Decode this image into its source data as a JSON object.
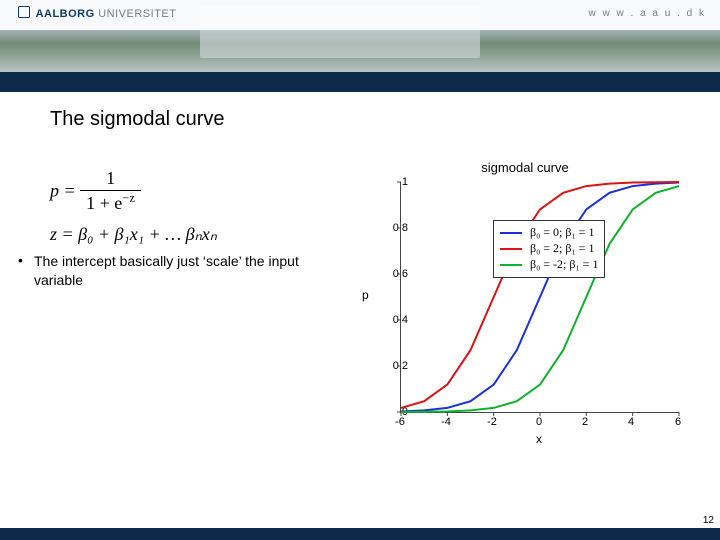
{
  "header": {
    "university_prefix": "AALBORG",
    "university_suffix": "UNIVERSITET",
    "url": "w w w . a a u . d k"
  },
  "title": "The sigmodal curve",
  "formula": {
    "line1_lhs": "p =",
    "line1_num": "1",
    "line1_den_a": "1 + e",
    "line1_den_sup": "−z",
    "line2": "z = β₀ + β₁x₁ + … βₙxₙ"
  },
  "bullet": "•",
  "bullet_text": "The intercept basically just ‘scale’ the input variable",
  "page_number": "12",
  "chart": {
    "title": "sigmodal curve",
    "xlabel": "x",
    "ylabel": "p",
    "y_ticks": [
      "0",
      "0.2",
      "0.4",
      "0.6",
      "0.8",
      "1"
    ],
    "x_ticks": [
      "-6",
      "-4",
      "-2",
      "0",
      "2",
      "4",
      "6"
    ],
    "legend": [
      {
        "label": "β₀ = 0;  β₁ = 1",
        "color": "#1a30d8"
      },
      {
        "label": "β₀ = 2;  β₁ = 1",
        "color": "#d81414"
      },
      {
        "label": "β₀ = -2; β₁ = 1",
        "color": "#11b02e"
      }
    ]
  },
  "chart_data": {
    "type": "line",
    "title": "sigmodal curve",
    "xlabel": "x",
    "ylabel": "p",
    "xlim": [
      -6,
      6
    ],
    "ylim": [
      0,
      1
    ],
    "x": [
      -6,
      -5,
      -4,
      -3,
      -2,
      -1,
      0,
      1,
      2,
      3,
      4,
      5,
      6
    ],
    "series": [
      {
        "name": "β0=0; β1=1",
        "color": "#1a30d8",
        "values": [
          0.002,
          0.007,
          0.018,
          0.047,
          0.119,
          0.269,
          0.5,
          0.731,
          0.881,
          0.953,
          0.982,
          0.993,
          0.998
        ]
      },
      {
        "name": "β0=2; β1=1",
        "color": "#d81414",
        "values": [
          0.018,
          0.047,
          0.119,
          0.269,
          0.5,
          0.731,
          0.881,
          0.953,
          0.982,
          0.993,
          0.998,
          0.999,
          1.0
        ]
      },
      {
        "name": "β0=-2; β1=1",
        "color": "#11b02e",
        "values": [
          0.0,
          0.001,
          0.002,
          0.007,
          0.018,
          0.047,
          0.119,
          0.269,
          0.5,
          0.731,
          0.881,
          0.953,
          0.982
        ]
      }
    ]
  }
}
